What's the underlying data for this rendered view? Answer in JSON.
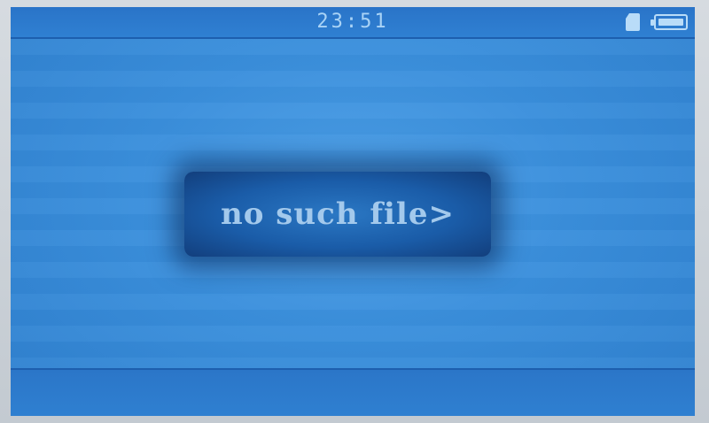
{
  "status_bar": {
    "clock": "23:51",
    "sd_icon": "sd-card-icon",
    "battery_icon": "battery-full-icon"
  },
  "dialog": {
    "message": "no such file>"
  },
  "colors": {
    "screen_blue": "#3a8fdc",
    "bar_blue": "#2a74c8",
    "text_light": "#a3c9ec"
  }
}
